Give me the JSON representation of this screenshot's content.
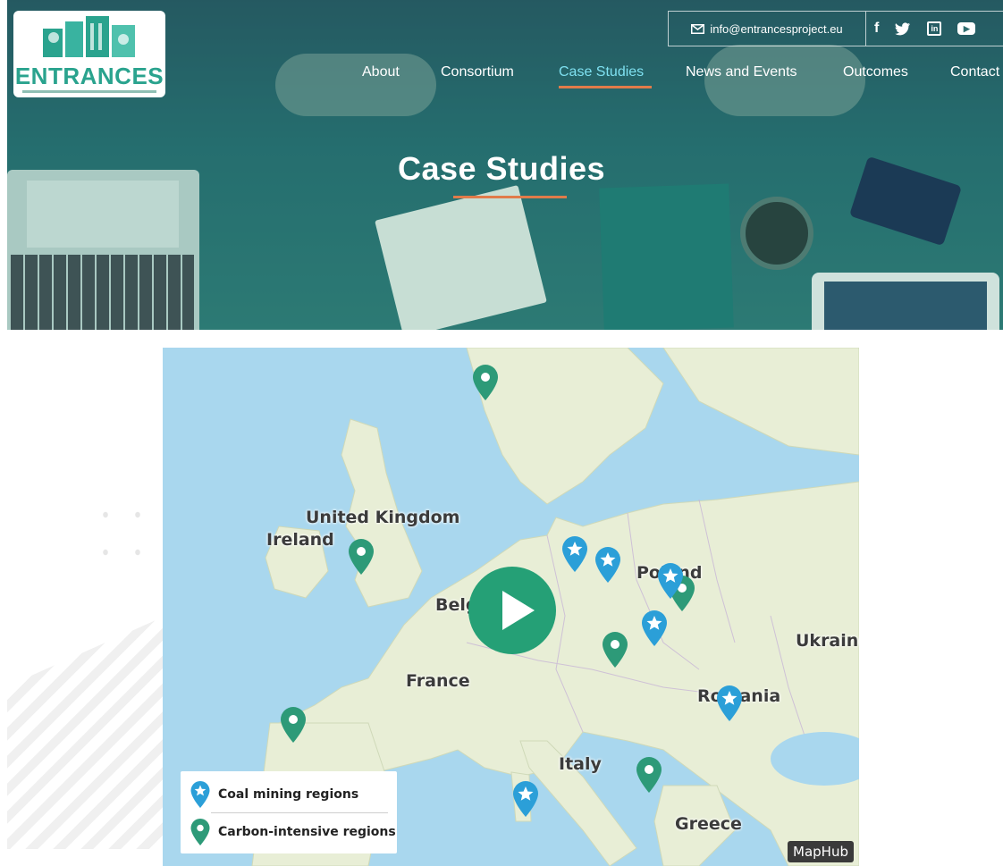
{
  "header": {
    "logo_text": "ENTRANCES",
    "contact_email": "info@entrancesproject.eu",
    "social_icons": [
      "facebook-icon",
      "twitter-icon",
      "linkedin-icon",
      "youtube-icon"
    ],
    "nav": [
      {
        "label": "About",
        "active": false
      },
      {
        "label": "Consortium",
        "active": false
      },
      {
        "label": "Case Studies",
        "active": true
      },
      {
        "label": "News and Events",
        "active": false
      },
      {
        "label": "Outcomes",
        "active": false
      },
      {
        "label": "Contact",
        "active": false
      }
    ],
    "accent_color": "#e07b4a"
  },
  "hero": {
    "title": "Case Studies"
  },
  "map": {
    "labels": [
      "United Kingdom",
      "Ireland",
      "Belgium",
      "France",
      "Poland",
      "Ukraine",
      "Romania",
      "Italy",
      "Greece"
    ],
    "legend": {
      "coal": "Coal mining regions",
      "carbon": "Carbon-intensive regions"
    },
    "coal_color": "#2b9fd8",
    "carbon_color": "#2d9a78",
    "attribution": "MapHub",
    "play_button": "play-icon"
  }
}
